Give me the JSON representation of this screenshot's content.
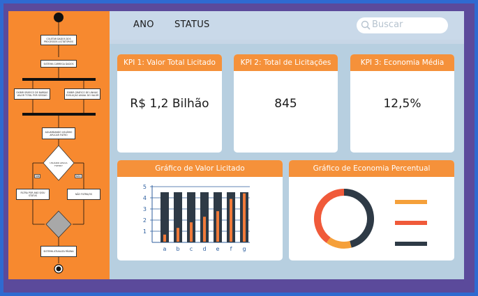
{
  "flowchart": {
    "steps": {
      "collect": "COLETAR DADOS DOS PROCESSOS LICITATÓRIOS",
      "load": "SISTEMA CARREGA DADOS",
      "bar_chart": "EXIBIR GRÁFICO DE BARRAS VALOR TOTAL POR SESSÃO",
      "line_chart": "EXIBIR GRÁFICO DE LINHAS EVOLUÇÃO ANUAL DO VALOR",
      "wait": "AGUARDANDO USUÁRIO APLICAR FILTRO",
      "decision": "USUÁRIO APLICA FILTRO?",
      "yes": "SIM",
      "no": "NÃO",
      "filter": "FILTRA POR ANO E/OU STATUS",
      "no_filter": "NÃO FILTRA/OS",
      "update": "SISTEMA ATUALIZA PÁGINA"
    }
  },
  "header": {
    "menu": [
      "ANO",
      "STATUS"
    ],
    "search_placeholder": "Buscar"
  },
  "kpis": [
    {
      "title": "KPI 1: Valor Total Licitado",
      "value": "R$ 1,2 Bilhão"
    },
    {
      "title": "KPI 2: Total de Licitações",
      "value": "845"
    },
    {
      "title": "KPI 3: Economia Média",
      "value": "12,5%"
    }
  ],
  "colors": {
    "accent": "#f5913a",
    "dark": "#2e3a46",
    "red": "#f05a3a"
  },
  "bar_chart": {
    "title": "Gráfico de Valor Licitado",
    "chart_data": {
      "type": "bar",
      "categories": [
        "a",
        "b",
        "c",
        "d",
        "e",
        "f",
        "g"
      ],
      "series": [
        {
          "values": [
            4.5,
            4.5,
            4.5,
            4.5,
            4.5,
            4.5,
            4.5
          ]
        },
        {
          "values": [
            0.7,
            1.3,
            1.8,
            2.3,
            2.8,
            3.9,
            4.4
          ]
        }
      ],
      "yticks": [
        "1",
        "2",
        "3",
        "4",
        "5"
      ],
      "ylim": [
        0,
        5
      ]
    }
  },
  "donut_chart": {
    "title": "Gráfico de Economia Percentual",
    "chart_data": {
      "type": "pie",
      "values": [
        46,
        14,
        40
      ],
      "colors": [
        "#2e3a46",
        "#f5a03a",
        "#f05a3a"
      ]
    }
  }
}
